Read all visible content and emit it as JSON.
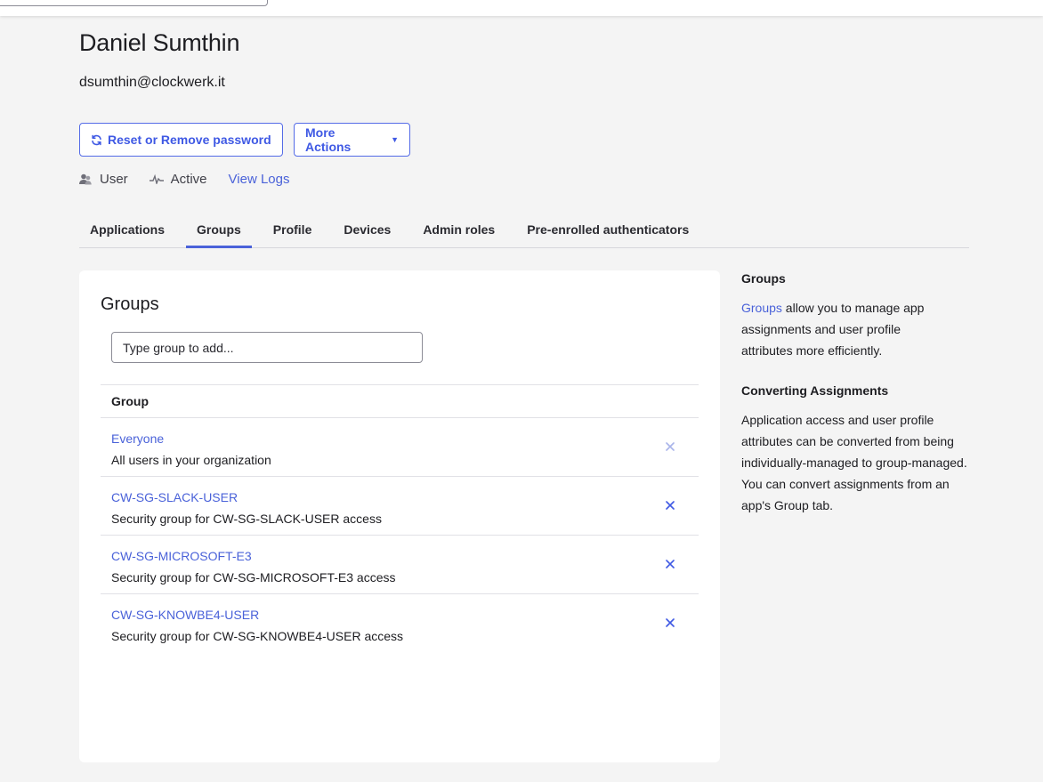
{
  "user": {
    "name": "Daniel Sumthin",
    "email": "dsumthin@clockwerk.it",
    "type": "User",
    "status": "Active",
    "view_logs": "View Logs"
  },
  "actions": {
    "reset_label": "Reset or Remove password",
    "more_label": "More Actions",
    "reset_icon": "refresh-icon",
    "more_icon": "caret-down-icon"
  },
  "tabs": [
    {
      "label": "Applications",
      "active": false
    },
    {
      "label": "Groups",
      "active": true
    },
    {
      "label": "Profile",
      "active": false
    },
    {
      "label": "Devices",
      "active": false
    },
    {
      "label": "Admin roles",
      "active": false
    },
    {
      "label": "Pre-enrolled authenticators",
      "active": false
    }
  ],
  "groups_panel": {
    "title": "Groups",
    "input_placeholder": "Type group to add...",
    "column_header": "Group",
    "rows": [
      {
        "name": "Everyone",
        "description": "All users in your organization",
        "removable": false
      },
      {
        "name": "CW-SG-SLACK-USER",
        "description": "Security group for CW-SG-SLACK-USER access",
        "removable": true
      },
      {
        "name": "CW-SG-MICROSOFT-E3",
        "description": "Security group for CW-SG-MICROSOFT-E3 access",
        "removable": true
      },
      {
        "name": "CW-SG-KNOWBE4-USER",
        "description": "Security group for CW-SG-KNOWBE4-USER access",
        "removable": true
      }
    ]
  },
  "sidebar": {
    "heading1": "Groups",
    "p1_link": "Groups",
    "p1_text": " allow you to manage app assignments and user profile attributes more efficiently.",
    "heading2": "Converting Assignments",
    "p2_text": "Application access and user profile attributes can be converted from being individually-managed to group-managed. You can convert assignments from an app's Group tab."
  },
  "colors": {
    "accent": "#4a62d9",
    "remove_active": "#3f59e4",
    "remove_disabled": "#a9b4ea"
  }
}
